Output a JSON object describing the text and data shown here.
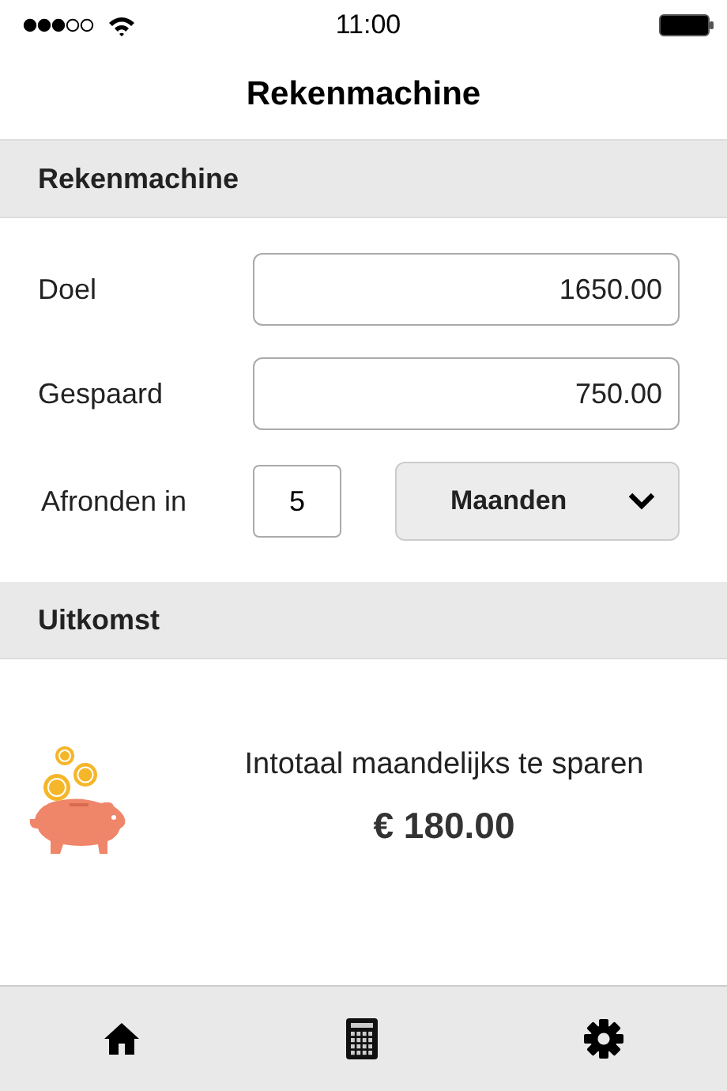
{
  "status_bar": {
    "time": "11:00"
  },
  "nav": {
    "title": "Rekenmachine"
  },
  "calculator": {
    "header": "Rekenmachine",
    "fields": [
      {
        "label": "Doel",
        "value": "1650.00"
      },
      {
        "label": "Gespaard",
        "value": "750.00"
      }
    ],
    "period": {
      "label": "Afronden in",
      "value": "5",
      "unit": "Maanden"
    }
  },
  "result": {
    "header": "Uitkomst",
    "label": "Intotaal maandelijks te sparen",
    "amount": "€ 180.00"
  }
}
